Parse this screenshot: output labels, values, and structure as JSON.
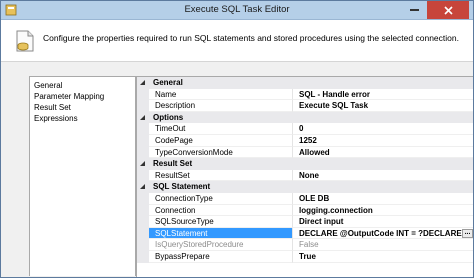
{
  "window": {
    "title": "Execute SQL Task Editor"
  },
  "header": {
    "description": "Configure the properties required to run SQL statements and stored procedures using the selected connection."
  },
  "nav": {
    "items": [
      {
        "label": "General"
      },
      {
        "label": "Parameter Mapping"
      },
      {
        "label": "Result Set"
      },
      {
        "label": "Expressions"
      }
    ]
  },
  "grid": {
    "general": {
      "label": "General",
      "rows": [
        {
          "name": "Name",
          "value": "SQL - Handle error"
        },
        {
          "name": "Description",
          "value": "Execute SQL Task"
        }
      ]
    },
    "options": {
      "label": "Options",
      "rows": [
        {
          "name": "TimeOut",
          "value": "0"
        },
        {
          "name": "CodePage",
          "value": "1252"
        },
        {
          "name": "TypeConversionMode",
          "value": "Allowed"
        }
      ]
    },
    "result_set": {
      "label": "Result Set",
      "rows": [
        {
          "name": "ResultSet",
          "value": "None"
        }
      ]
    },
    "sql_statement": {
      "label": "SQL Statement",
      "rows": [
        {
          "name": "ConnectionType",
          "value": "OLE DB"
        },
        {
          "name": "Connection",
          "value": "logging.connection"
        },
        {
          "name": "SQLSourceType",
          "value": "Direct input"
        },
        {
          "name": "SQLStatement",
          "value": "DECLARE @OutputCode INT = ?DECLARE @S"
        },
        {
          "name": "IsQueryStoredProcedure",
          "value": "False"
        },
        {
          "name": "BypassPrepare",
          "value": "True"
        }
      ]
    },
    "ellipsis_label": "..."
  },
  "colors": {
    "selection": "#3399ff",
    "close_button": "#c7453b",
    "titlebar": "#b5cfe8"
  }
}
